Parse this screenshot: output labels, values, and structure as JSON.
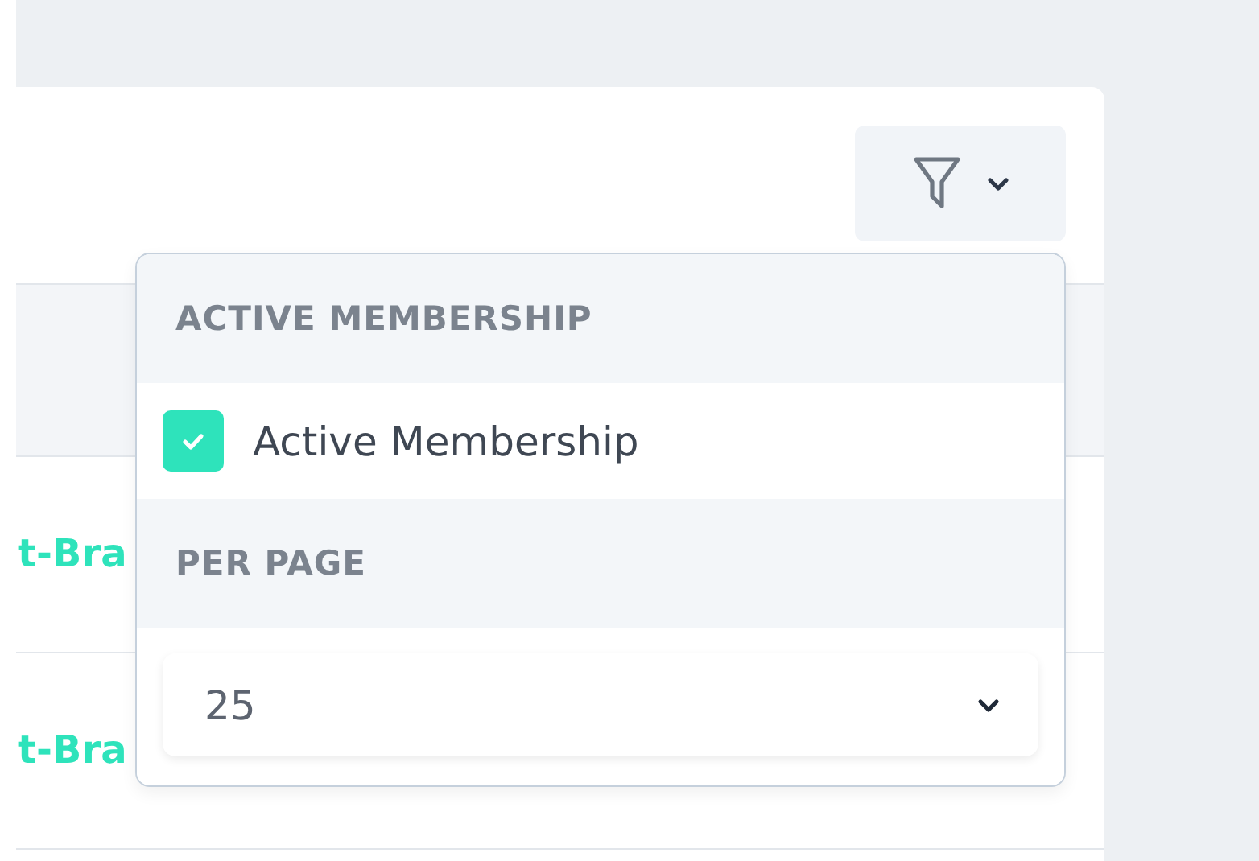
{
  "table": {
    "rows": [
      {
        "column_1": "t-Bra"
      },
      {
        "column_1": "t-Bra"
      }
    ]
  },
  "filter_menu": {
    "expanded": true,
    "sections": [
      {
        "kind": "checkbox",
        "heading": "ACTIVE MEMBERSHIP",
        "label": "Active Membership",
        "checked": true
      },
      {
        "kind": "select",
        "heading": "PER PAGE",
        "value": "25"
      }
    ]
  }
}
